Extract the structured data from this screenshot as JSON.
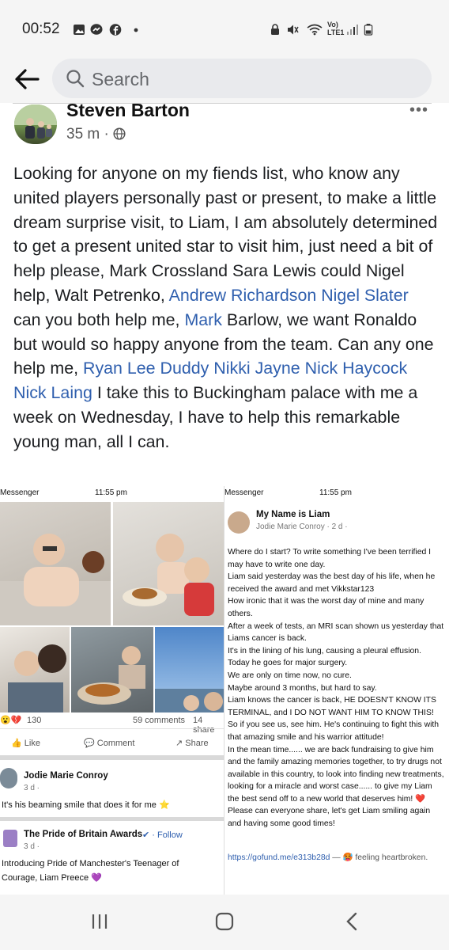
{
  "status_bar": {
    "time": "00:52",
    "icons": [
      "gallery-icon",
      "messenger-icon",
      "facebook-icon",
      "dot-icon",
      "lock-icon",
      "mute-icon",
      "wifi-icon",
      "volte-icon",
      "signal-icon",
      "battery-icon"
    ],
    "volte_label": "Vo)\nLTE1"
  },
  "search": {
    "placeholder": "Search"
  },
  "post": {
    "author": "Steven Barton",
    "time": "35 m",
    "privacy_icon": "globe-icon",
    "more": "•••",
    "text_segments": [
      {
        "text": "Looking for anyone on my fiends list,  who know any united players personally past or present, to make a little dream surprise visit,  to Liam, I am absolutely determined to get a present united star to visit him, just need a bit of help please, Mark Crossland Sara Lewis could Nigel help, Walt Petrenko, ",
        "tag": false
      },
      {
        "text": "Andrew Richardson",
        "tag": true
      },
      {
        "text": " ",
        "tag": false
      },
      {
        "text": "Nigel Slater",
        "tag": true
      },
      {
        "text": " can you both help me, ",
        "tag": false
      },
      {
        "text": "Mark",
        "tag": true
      },
      {
        "text": " Barlow, we want Ronaldo but would so happy anyone from the team. Can any one help me, ",
        "tag": false
      },
      {
        "text": "Ryan Lee Duddy",
        "tag": true
      },
      {
        "text": " ",
        "tag": false
      },
      {
        "text": "Nikki Jayne",
        "tag": true
      },
      {
        "text": " ",
        "tag": false
      },
      {
        "text": "Nick Haycock",
        "tag": true
      },
      {
        "text": " ",
        "tag": false
      },
      {
        "text": "Nick Laing",
        "tag": true
      },
      {
        "text": " I take this to Buckingham palace with me a week on Wednesday, I have to help this remarkable young man, all I can.",
        "tag": false
      }
    ]
  },
  "collage": {
    "left": {
      "status": {
        "app": "Messenger",
        "time": "11:55 pm"
      },
      "reaction_count": "130",
      "comments_count": "59 comments",
      "shares_count": "14 share",
      "like_label": "Like",
      "comment_label": "Comment",
      "share_label": "Share",
      "comment1": {
        "name": "Jodie Marie Conroy",
        "meta": "3 d ·",
        "text": "It's his beaming smile that does it for me ⭐"
      },
      "comment2": {
        "name": "The Pride of Britain Awards",
        "follow": "· Follow",
        "meta": "3 d ·",
        "text": "Introducing Pride of Manchester's Teenager of Courage, Liam Preece 💜"
      }
    },
    "right": {
      "status": {
        "app": "Messenger",
        "time": "11:55 pm"
      },
      "group": "My Name is Liam",
      "poster": "Jodie Marie Conroy · 2 d ·",
      "body": "Where do I start? To write something I've been terrified I may have to write one day.\nLiam said yesterday was the best day of his life, when he received the award and met Vikkstar123\nHow ironic that it was the worst day of mine and many others.\nAfter a week of tests, an MRI scan shown us yesterday that Liams cancer is back.\nIt's in the lining of his lung, causing a pleural effusion.\nToday he goes for major surgery.\nWe are only on time now, no cure.\nMaybe around 3 months, but hard to say.\nLiam knows the cancer is back, HE DOESN'T KNOW ITS TERMINAL, and I DO NOT WANT HIM TO KNOW THIS! So if you see us, see him. He's continuing to fight this with that amazing smile and his warrior attitude!\nIn the mean time...... we are back fundraising to give him and the family amazing memories together, to try drugs not available in this country, to look into finding new treatments, looking for a miracle and worst case...... to give my Liam the best send off to a new world that deserves him! ❤️\nPlease can everyone share, let's get Liam smiling again and having some good times!",
      "link": "https://gofund.me/e313b28d",
      "feeling": " — 🥵 feeling heartbroken."
    }
  },
  "nav": {
    "icons": [
      "recent-apps-icon",
      "home-icon",
      "back-icon"
    ]
  }
}
